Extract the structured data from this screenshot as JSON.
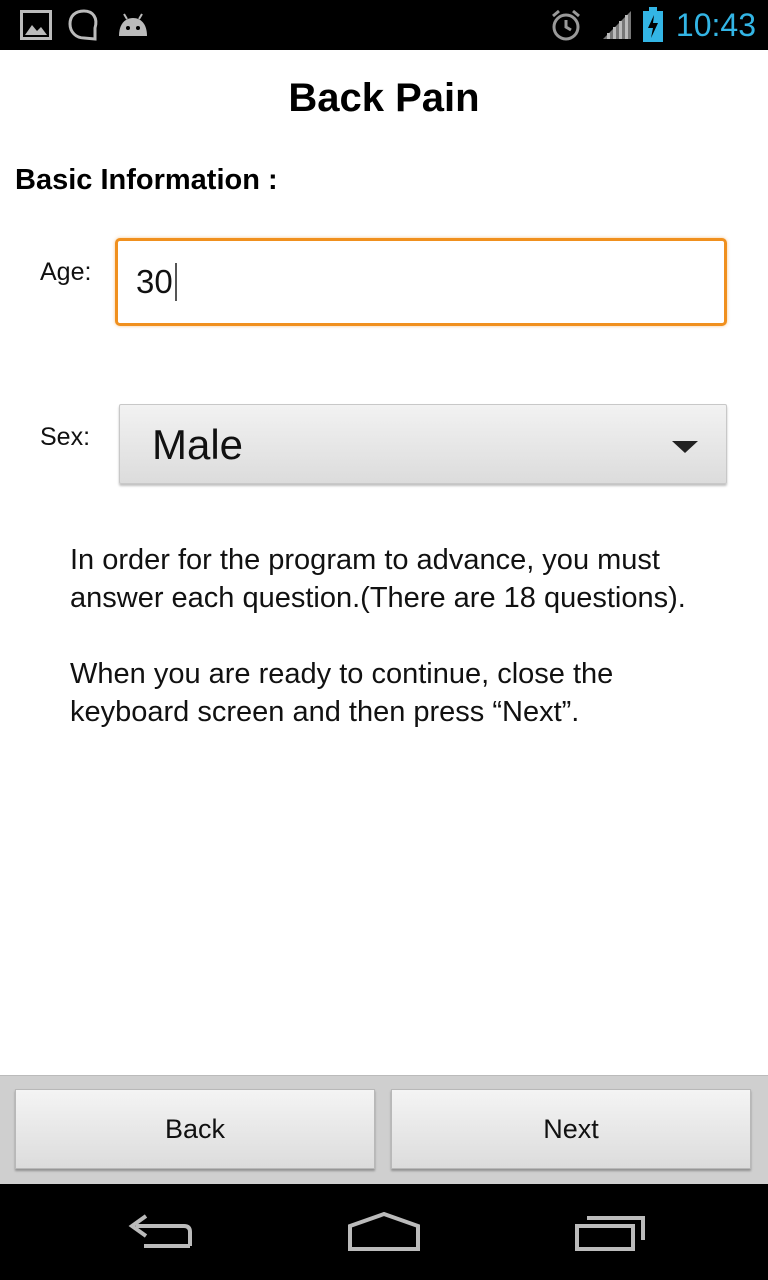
{
  "status_bar": {
    "time": "10:43",
    "icons": [
      "image-notification-icon",
      "hangouts-icon",
      "android-icon",
      "alarm-icon",
      "signal-icon",
      "battery-icon"
    ],
    "time_color": "#33b5e5"
  },
  "page": {
    "title": "Back Pain",
    "section_heading": "Basic Information :"
  },
  "form": {
    "age_label": "Age:",
    "age_value": "30",
    "sex_label": "Sex:",
    "sex_selected": "Male",
    "focus_color": "#f0901e"
  },
  "instructions": {
    "paragraph1": "In order for the program to advance, you must answer each question.(There are 18 questions).",
    "paragraph2": "When you are ready to continue, close the keyboard screen and then press “Next”."
  },
  "buttons": {
    "back_label": "Back",
    "next_label": "Next"
  },
  "nav_bar": {
    "icons": [
      "back-nav-icon",
      "home-nav-icon",
      "recent-apps-icon"
    ]
  }
}
